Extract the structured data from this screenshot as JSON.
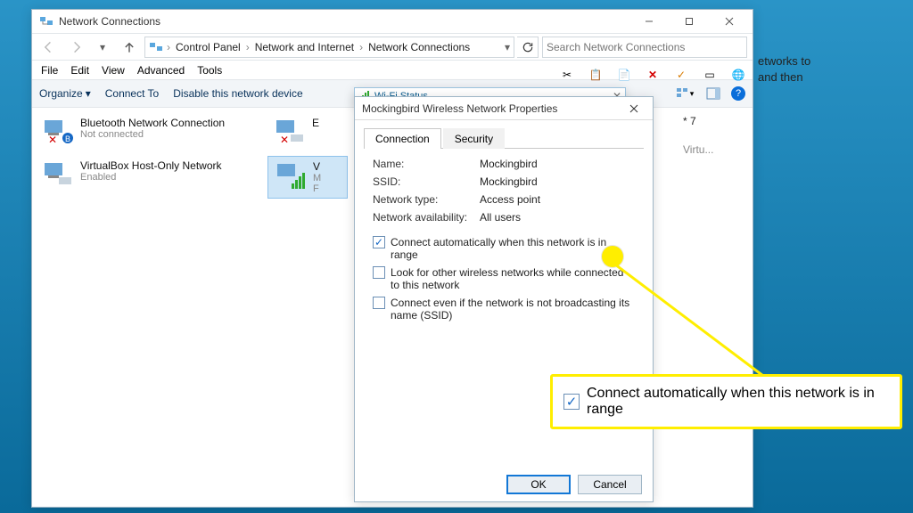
{
  "mainWindow": {
    "title": "Network Connections",
    "captions": {
      "minimize": "–",
      "maximize": "□"
    },
    "breadcrumb": [
      "Control Panel",
      "Network and Internet",
      "Network Connections"
    ],
    "searchPlaceholder": "Search Network Connections",
    "menu": [
      "File",
      "Edit",
      "View",
      "Advanced",
      "Tools"
    ],
    "cmdbar": {
      "organize": "Organize",
      "connect": "Connect To",
      "disable": "Disable this network device"
    }
  },
  "adapters": {
    "bluetooth": {
      "name": "Bluetooth Network Connection",
      "status": "Not connected"
    },
    "virtualbox": {
      "name": "VirtualBox Host-Only Network",
      "status": "Enabled"
    },
    "eth": {
      "initial": "E"
    },
    "wifi": {
      "initial": "V",
      "sub1": "M",
      "sub2": "F"
    },
    "right1": "* 7",
    "right2": "Virtu..."
  },
  "wifiStatus": {
    "title": "Wi-Fi Status"
  },
  "props": {
    "title": "Mockingbird Wireless Network Properties",
    "tabs": {
      "connection": "Connection",
      "security": "Security"
    },
    "fields": {
      "nameLabel": "Name:",
      "name": "Mockingbird",
      "ssidLabel": "SSID:",
      "ssid": "Mockingbird",
      "typeLabel": "Network type:",
      "type": "Access point",
      "availLabel": "Network availability:",
      "avail": "All users"
    },
    "checks": {
      "auto": "Connect automatically when this network is in range",
      "look": "Look for other wireless networks while connected to this network",
      "broadcast": "Connect even if the network is not broadcasting its name (SSID)"
    },
    "buttons": {
      "ok": "OK",
      "cancel": "Cancel"
    }
  },
  "callout": {
    "text": "Connect automatically when this network is in range"
  },
  "bgTip": {
    "l1": "etworks to",
    "l2": " and then"
  },
  "icons": {
    "dd": "▾",
    "sep": "›"
  }
}
